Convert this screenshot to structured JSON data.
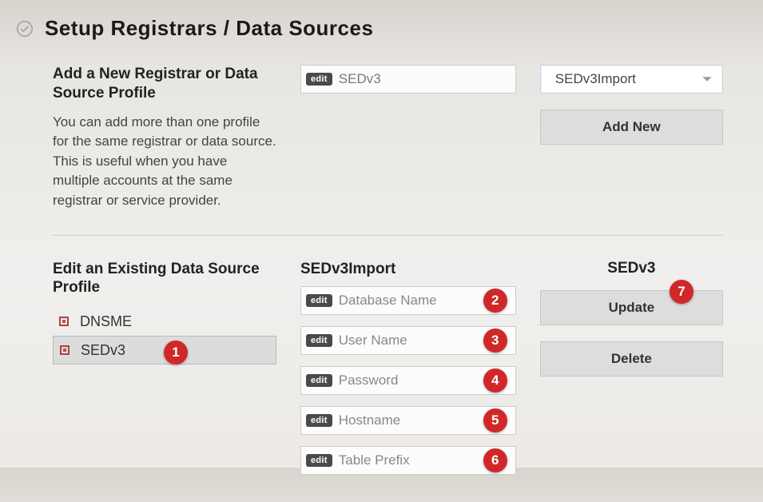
{
  "header": {
    "title": "Setup Registrars / Data Sources"
  },
  "add": {
    "section_title": "Add a New Registrar or Data Source Profile",
    "description": "You can add more than one profile for the same registrar or data source. This is useful when you have multiple accounts at the same registrar or service provider.",
    "name_value": "SEDv3",
    "select_value": "SEDv3Import",
    "add_button": "Add New"
  },
  "edit_section": {
    "title": "Edit an Existing Data Source Profile",
    "profiles": [
      {
        "label": "DNSME",
        "selected": false
      },
      {
        "label": "SEDv3",
        "selected": true
      }
    ]
  },
  "form": {
    "title": "SEDv3Import",
    "fields": [
      {
        "placeholder": "Database Name"
      },
      {
        "placeholder": "User Name"
      },
      {
        "placeholder": "Password"
      },
      {
        "placeholder": "Hostname"
      },
      {
        "placeholder": "Table Prefix"
      }
    ]
  },
  "actions": {
    "title": "SEDv3",
    "update": "Update",
    "delete": "Delete"
  },
  "badges": {
    "edit": "edit"
  },
  "annotations": [
    "1",
    "2",
    "3",
    "4",
    "5",
    "6",
    "7"
  ],
  "colors": {
    "annotation": "#d02828",
    "button_bg": "#dddddd",
    "badge_bg": "#4a4a4a"
  }
}
